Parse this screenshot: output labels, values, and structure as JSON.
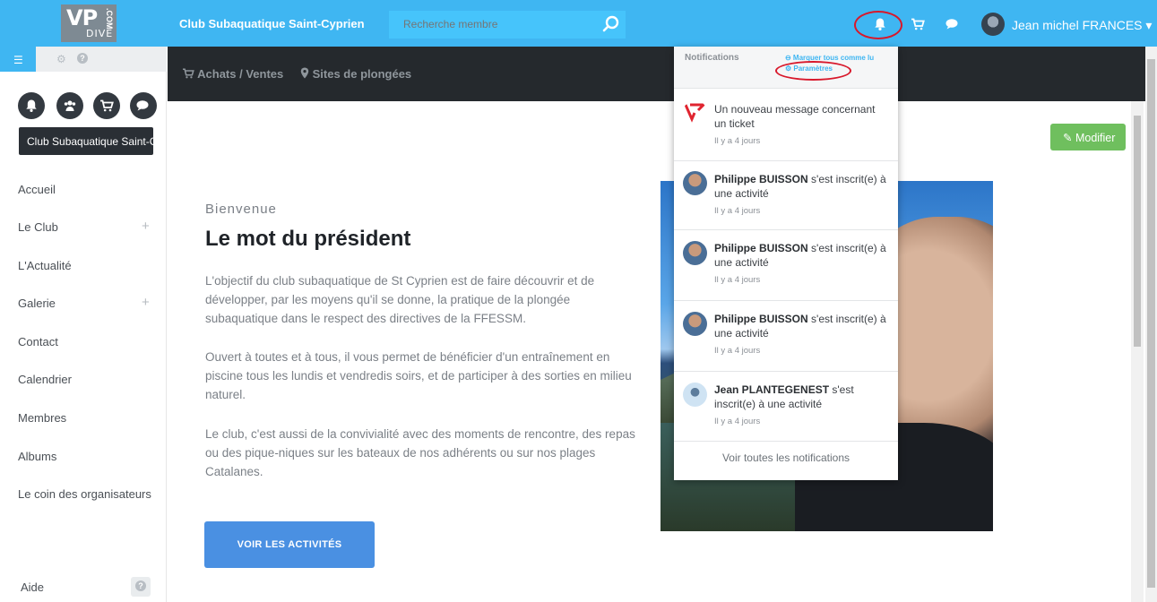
{
  "app": {
    "logo_text_vp": "VP",
    "logo_text_dive": "DIVE",
    "logo_text_com": ".COM",
    "club_name": "Club Subaquatique Saint-Cyprien",
    "accent_color": "#3fb6f2",
    "alert_color": "#d8182b"
  },
  "search": {
    "placeholder": "Recherche membre",
    "icon": "search-icon"
  },
  "topbar": {
    "icons": [
      "bell-icon",
      "cart-icon",
      "chat-icon"
    ],
    "user_name": "Jean michel FRANCES"
  },
  "sidebar": {
    "tab_icons": [
      "menu-icon",
      "gear-icon",
      "help-icon"
    ],
    "round_buttons": [
      "bell-icon",
      "users-icon",
      "cart-icon",
      "chat-icon"
    ],
    "club_chip": "Club Subaquatique Saint-Cyprien",
    "items": [
      {
        "label": "Accueil",
        "expandable": false
      },
      {
        "label": "Le Club",
        "expandable": true
      },
      {
        "label": "L'Actualité",
        "expandable": false
      },
      {
        "label": "Galerie",
        "expandable": true
      },
      {
        "label": "Contact",
        "expandable": false
      },
      {
        "label": "Calendrier",
        "expandable": false
      },
      {
        "label": "Membres",
        "expandable": false
      },
      {
        "label": "Albums",
        "expandable": false
      },
      {
        "label": "Le coin des organisateurs",
        "expandable": false
      }
    ],
    "help_label": "Aide"
  },
  "subnav": {
    "items": [
      {
        "label": "Achats / Ventes",
        "icon": "cart-icon"
      },
      {
        "label": "Sites de plongées",
        "icon": "map-marker-icon"
      }
    ]
  },
  "main": {
    "edit_button": "Modifier",
    "welcome": "Bienvenue",
    "heading": "Le mot du président",
    "paragraphs": [
      "L'objectif du club subaquatique de St Cyprien est de faire découvrir et de développer, par les moyens qu'il se donne, la pratique de la plongée subaquatique dans le respect des directives de la FFESSM.",
      "Ouvert à toutes et à tous, il vous permet de bénéficier d'un entraînement en piscine tous les lundis et vendredis soirs, et de participer à des sorties en milieu naturel.",
      "Le club, c'est aussi de la convivialité avec des moments de rencontre, des repas ou des pique-niques sur les bateaux de nos adhérents ou sur nos plages Catalanes."
    ],
    "cta": "VOIR LES ACTIVITÉS"
  },
  "notifications": {
    "title": "Notifications",
    "mark_all": "⊖ Marquer tous comme lu",
    "settings": "⚙ Paramètres",
    "items": [
      {
        "name": "",
        "text": "Un nouveau message concernant un ticket",
        "time": "Il y a 4 jours",
        "avatar": "vp-logo"
      },
      {
        "name": "Philippe BUISSON",
        "text": " s'est inscrit(e) à une activité",
        "time": "Il y a 4 jours",
        "avatar": "photo"
      },
      {
        "name": "Philippe BUISSON",
        "text": " s'est inscrit(e) à une activité",
        "time": "Il y a 4 jours",
        "avatar": "photo"
      },
      {
        "name": "Philippe BUISSON",
        "text": " s'est inscrit(e) à une activité",
        "time": "Il y a 4 jours",
        "avatar": "photo"
      },
      {
        "name": "Jean PLANTEGENEST",
        "text": " s'est inscrit(e) à une activité",
        "time": "Il y a 4 jours",
        "avatar": "diver"
      }
    ],
    "see_all": "Voir toutes les notifications"
  }
}
